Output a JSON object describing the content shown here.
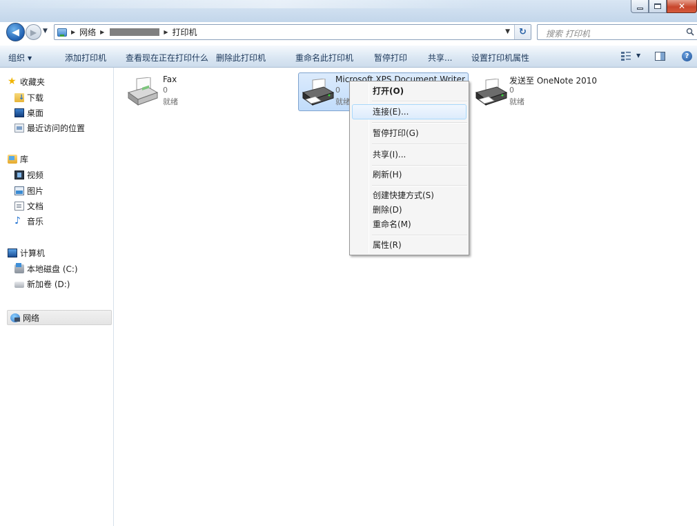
{
  "window": {
    "minimize_symbol": "—",
    "maximize_symbol": "□",
    "close_symbol": "✕"
  },
  "address_bar": {
    "crumbs": [
      "网络",
      "打印机"
    ],
    "redacted_segment": true
  },
  "search": {
    "placeholder": "搜索 打印机"
  },
  "toolbar": {
    "organize": "组织",
    "add_printer": "添加打印机",
    "see_printing": "查看现在正在打印什么",
    "delete_printer": "删除此打印机",
    "rename_printer": "重命名此打印机",
    "pause_printing": "暂停打印",
    "share": "共享...",
    "printer_properties": "设置打印机属性"
  },
  "sidebar": {
    "favorites": {
      "label": "收藏夹",
      "items": [
        "下载",
        "桌面",
        "最近访问的位置"
      ]
    },
    "libraries": {
      "label": "库",
      "items": [
        "视频",
        "图片",
        "文档",
        "音乐"
      ]
    },
    "computer": {
      "label": "计算机",
      "items": [
        "本地磁盘 (C:)",
        "新加卷 (D:)"
      ]
    },
    "network": {
      "label": "网络"
    }
  },
  "printers": [
    {
      "name": "Fax",
      "jobs": "0",
      "status": "就绪"
    },
    {
      "name": "Microsoft XPS Document Writer",
      "jobs": "0",
      "status": "就绪"
    },
    {
      "name": "发送至 OneNote 2010",
      "jobs": "0",
      "status": "就绪"
    }
  ],
  "context_menu": {
    "open": "打开(O)",
    "connect": "连接(E)...",
    "pause": "暂停打印(G)",
    "share": "共享(I)...",
    "refresh": "刷新(H)",
    "create_shortcut": "创建快捷方式(S)",
    "delete": "删除(D)",
    "rename": "重命名(M)",
    "properties": "属性(R)"
  },
  "colors": {
    "toolbar_text": "#1e395b",
    "selection_bg": "#c1dcfb",
    "selection_border": "#7da2ce"
  }
}
